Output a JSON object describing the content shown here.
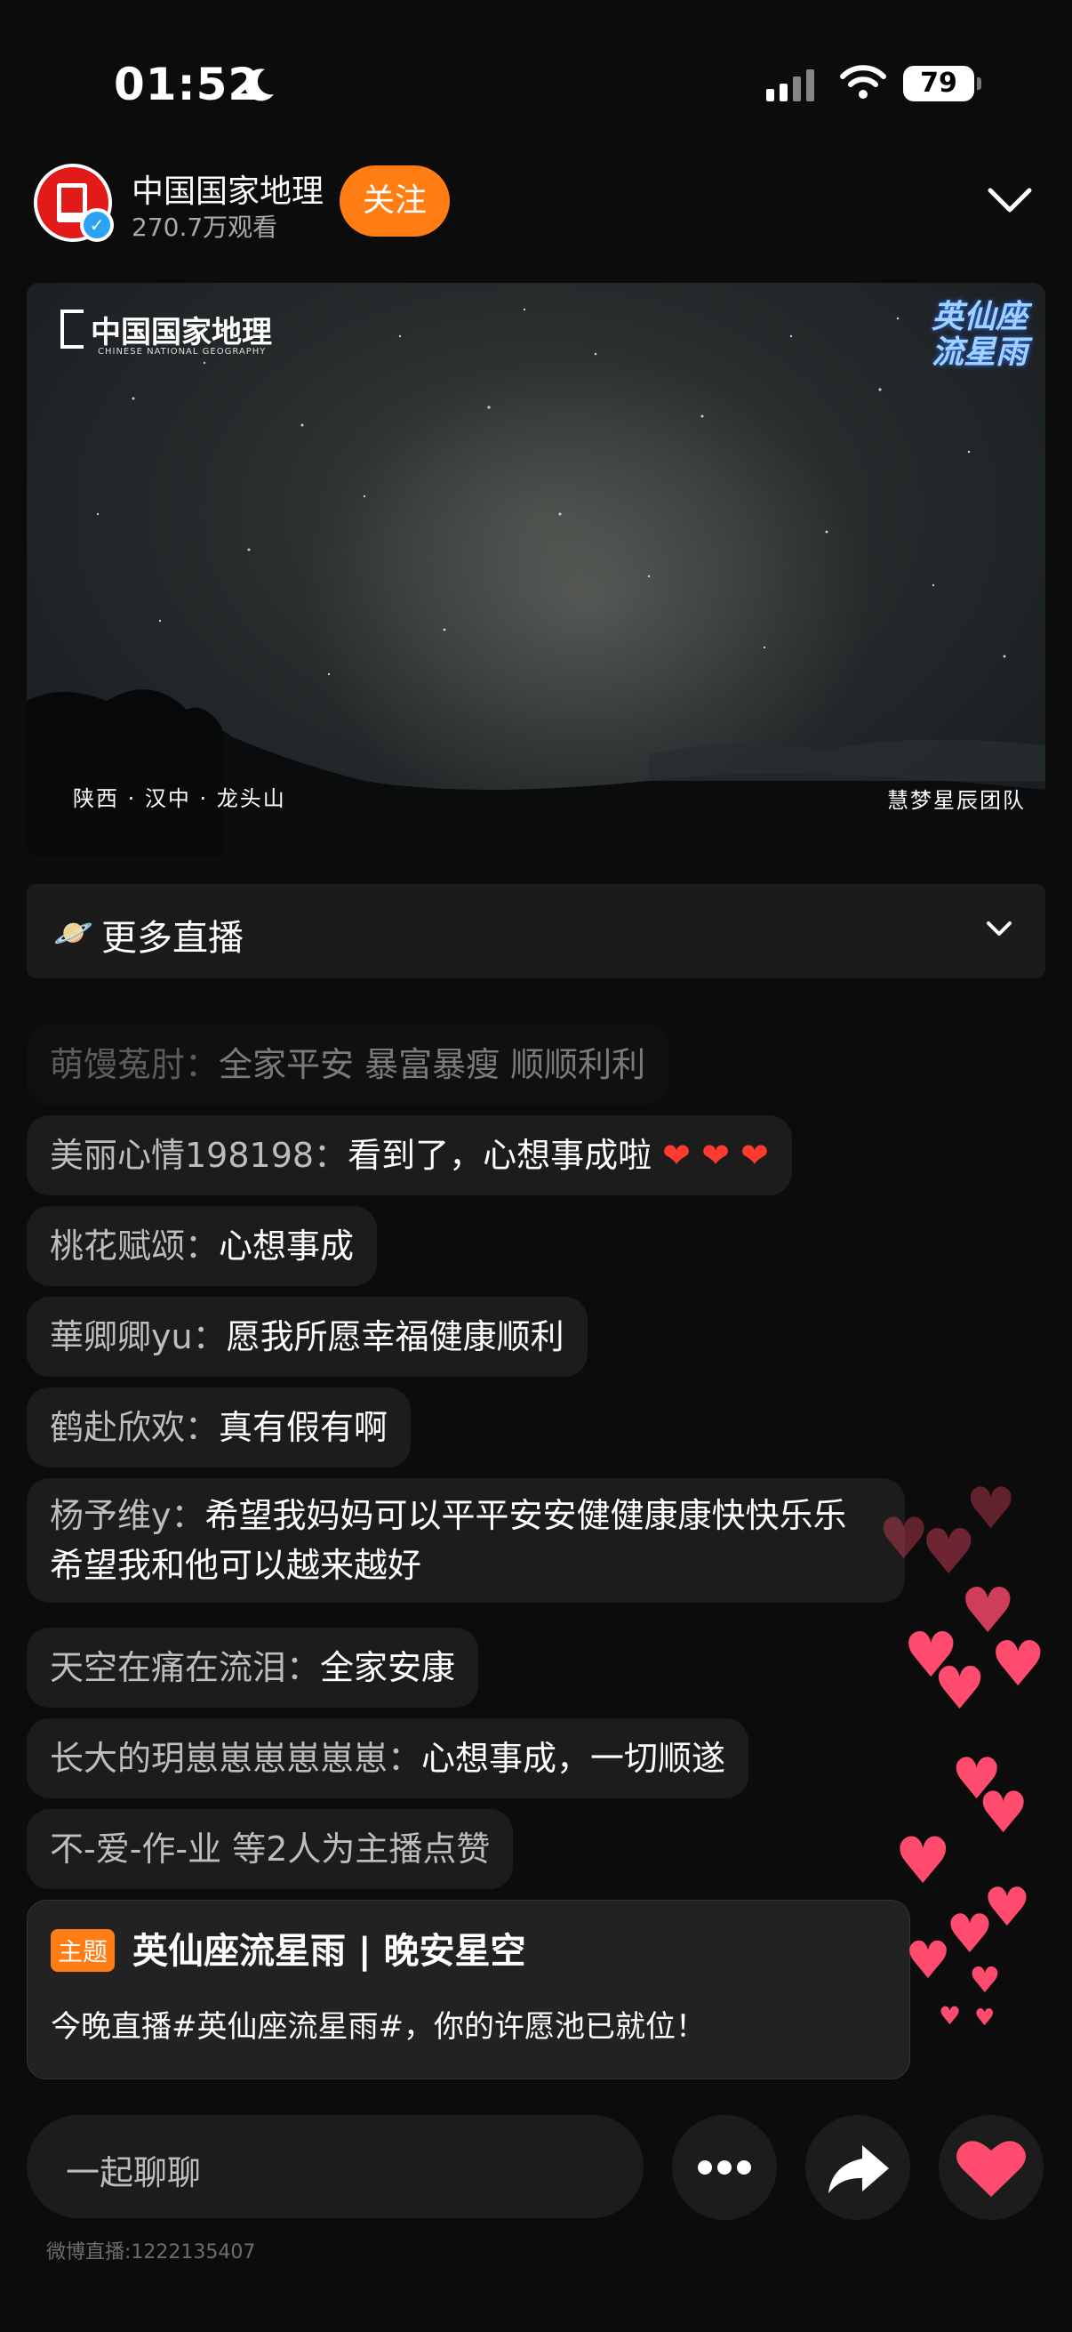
{
  "status_bar": {
    "time": "01:52",
    "battery": "79"
  },
  "header": {
    "account_name": "中国国家地理",
    "views": "270.7万观看",
    "follow_label": "关注"
  },
  "video": {
    "brand": "中国国家地理",
    "brand_en": "CHINESE NATIONAL GEOGRAPHY",
    "title_line1": "英仙座",
    "title_line2": "流星雨",
    "location": "陕西 · 汉中 · 龙头山",
    "credit": "慧梦星辰团队"
  },
  "more_live": {
    "icon": "🪐",
    "label": "更多直播"
  },
  "comments": [
    {
      "user": "萌馒菟肘：",
      "text": "全家平安 暴富暴瘦 顺顺利利"
    },
    {
      "user": "美丽心情198198：",
      "text": "看到了，心想事成啦",
      "hearts": "❤ ❤ ❤"
    },
    {
      "user": "桃花赋颂：",
      "text": "心想事成"
    },
    {
      "user": "華卿卿yu：",
      "text": "愿我所愿幸福健康顺利"
    },
    {
      "user": "鹤赴欣欢：",
      "text": "真有假有啊"
    },
    {
      "user": "杨予维y：",
      "text": "希望我妈妈可以平平安安健健康康快快乐乐 希望我和他可以越来越好"
    },
    {
      "user": "天空在痛在流泪：",
      "text": "全家安康"
    },
    {
      "user": "长大的玥崽崽崽崽崽崽：",
      "text": "心想事成，一切顺遂"
    },
    {
      "user": "不-爱-作-业 等2人为主播点赞",
      "text": ""
    }
  ],
  "topic": {
    "tag": "主题",
    "title": "英仙座流星雨 | 晚安星空",
    "desc": "今晚直播#英仙座流星雨#，你的许愿池已就位！"
  },
  "bottom": {
    "chat_placeholder": "一起聊聊",
    "room_id": "微博直播:1222135407"
  },
  "colors": {
    "accent": "#ff7d12",
    "heart": "#ff4b6e",
    "verified": "#2aa3f5"
  }
}
